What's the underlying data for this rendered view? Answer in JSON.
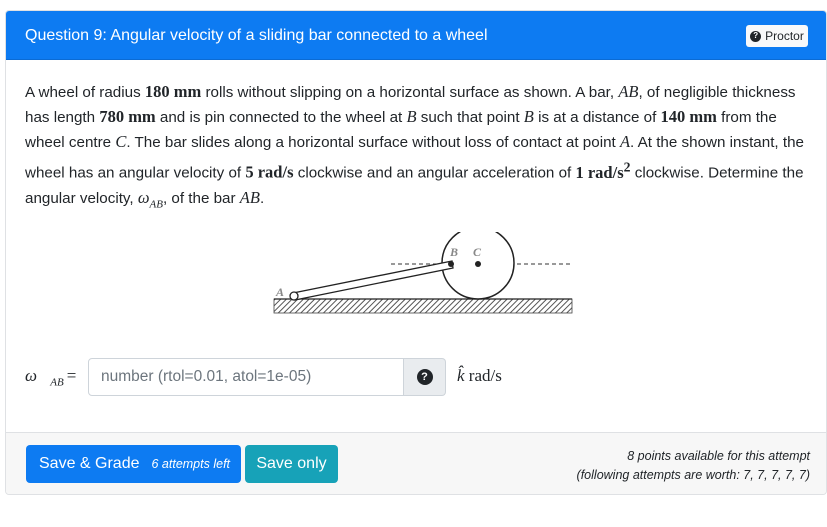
{
  "header": {
    "title": "Question 9: Angular velocity of a sliding bar connected to a wheel",
    "proctor_label": "Proctor"
  },
  "problem": {
    "t1": "A wheel of radius ",
    "m1": "180 mm",
    "t2": " rolls without slipping on a horizontal surface as shown. A bar, ",
    "m2": "AB",
    "t3": ", of negligible thickness has length ",
    "m3": "780 mm",
    "t4": " and is pin connected to the wheel at ",
    "m4": "B",
    "t5": " such that point ",
    "m5": "B",
    "t6": " is at a distance of ",
    "m6": "140 mm",
    "t7": " from the wheel centre ",
    "m7": "C",
    "t8": ". The bar slides along a horizontal surface without loss of contact at point ",
    "m8": "A",
    "t9": ". At the shown instant, the wheel has an angular velocity of ",
    "m9": "5 rad/s",
    "t10": " clockwise and an angular acceleration of ",
    "m10a": "1 rad/s",
    "m10b": "2",
    "t11": " clockwise. Determine the angular velocity, ",
    "m11a": "ω",
    "m11b": "AB",
    "t12": ", of the bar ",
    "m12": "AB",
    "t13": "."
  },
  "figure": {
    "label_a": "A",
    "label_b": "B",
    "label_c": "C"
  },
  "answer": {
    "symbol": "ω⃗",
    "subscript": "AB",
    "equals": "=",
    "placeholder": "number (rtol=0.01, atol=1e-05)",
    "value": "",
    "unit_hat": "k̂",
    "unit_text": " rad/s"
  },
  "footer": {
    "grade_label": "Save & Grade",
    "attempts_left": "6 attempts left",
    "save_label": "Save only",
    "points_line1": "8 points available for this attempt",
    "points_line2": "(following attempts are worth: 7, 7, 7, 7, 7)"
  },
  "colors": {
    "primary": "#0d7bf2",
    "info": "#17a2b8",
    "header_text": "#ffffff"
  },
  "icons": {
    "proctor": "question-circle-icon",
    "help": "question-circle-icon"
  }
}
